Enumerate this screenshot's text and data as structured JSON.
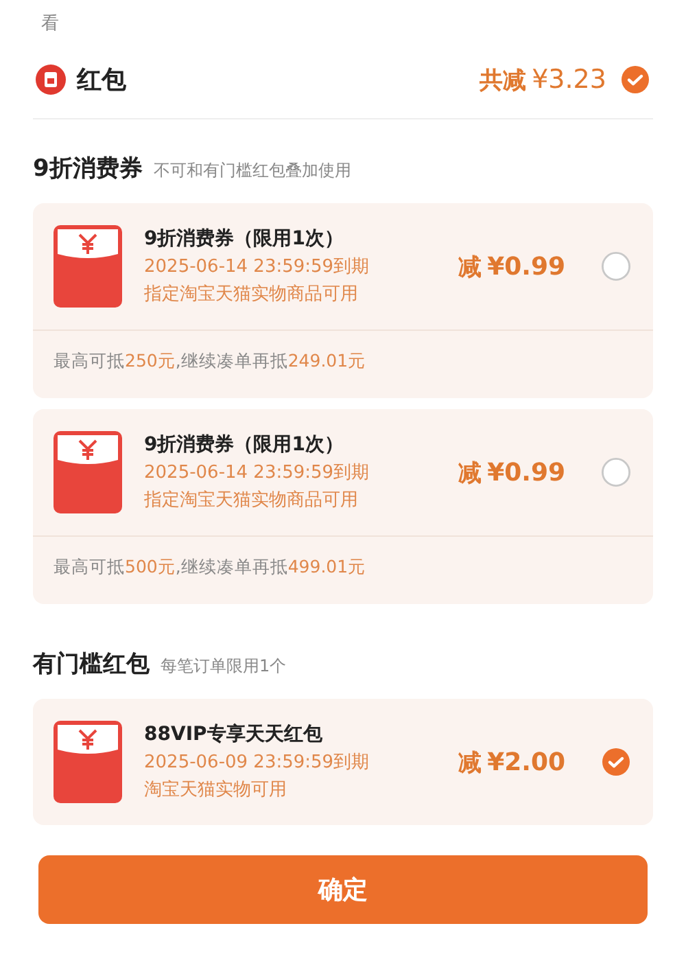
{
  "top_text": "看",
  "header": {
    "title": "红包",
    "total_label": "共减",
    "total_amount": "¥3.23",
    "selected": true
  },
  "sections": [
    {
      "title": "9折消费券",
      "note": "不可和有门槛红包叠加使用",
      "coupons": [
        {
          "name": "9折消费券（限用1次）",
          "expiry": "2025-06-14 23:59:59到期",
          "scope": "指定淘宝天猫实物商品可用",
          "prefix": "减",
          "amount": "¥0.99",
          "selected": false,
          "footer": [
            {
              "text": "最高可抵",
              "highlight": false
            },
            {
              "text": "250元",
              "highlight": true
            },
            {
              "text": ",继续凑单再抵",
              "highlight": false
            },
            {
              "text": "249.01元",
              "highlight": true
            }
          ]
        },
        {
          "name": "9折消费券（限用1次）",
          "expiry": "2025-06-14 23:59:59到期",
          "scope": "指定淘宝天猫实物商品可用",
          "prefix": "减",
          "amount": "¥0.99",
          "selected": false,
          "footer": [
            {
              "text": "最高可抵",
              "highlight": false
            },
            {
              "text": "500元",
              "highlight": true
            },
            {
              "text": ",继续凑单再抵",
              "highlight": false
            },
            {
              "text": "499.01元",
              "highlight": true
            }
          ]
        }
      ]
    },
    {
      "title": "有门槛红包",
      "note": "每笔订单限用1个",
      "coupons": [
        {
          "name": "88VIP专享天天红包",
          "expiry": "2025-06-09 23:59:59到期",
          "scope": "淘宝天猫实物可用",
          "prefix": "减",
          "amount": "¥2.00",
          "selected": true
        }
      ]
    }
  ],
  "confirm_button": "确定"
}
